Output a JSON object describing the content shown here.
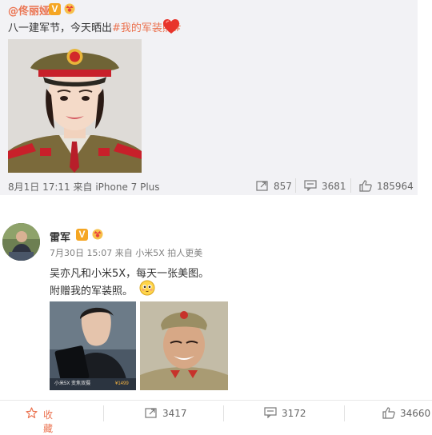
{
  "repost": {
    "author": "@佟丽娅",
    "v_badge": "V",
    "text_prefix": "八一建军节，今天晒出",
    "topic": "#我的军装照#",
    "time": "8月1日 17:11",
    "source_label": "来自",
    "source": "iPhone 7 Plus",
    "repost_count": "857",
    "comment_count": "3681",
    "like_count": "185964"
  },
  "post": {
    "author": "雷军",
    "v_badge": "V",
    "time": "7月30日 15:07",
    "source_label": "来自",
    "source": "小米5X 拍人更美",
    "line1": "吴亦凡和小米5X，每天一张美图。",
    "line2": "附赠我的军装照。",
    "ad_caption": "小米5X 变焦双摄",
    "ad_price": "¥1499"
  },
  "actions": {
    "favorite": "收藏",
    "repost": "3417",
    "comment": "3172",
    "like": "34660"
  },
  "colors": {
    "accent": "#eb7350",
    "badge": "#f5a623",
    "repost_bg": "#f2f2f5"
  }
}
